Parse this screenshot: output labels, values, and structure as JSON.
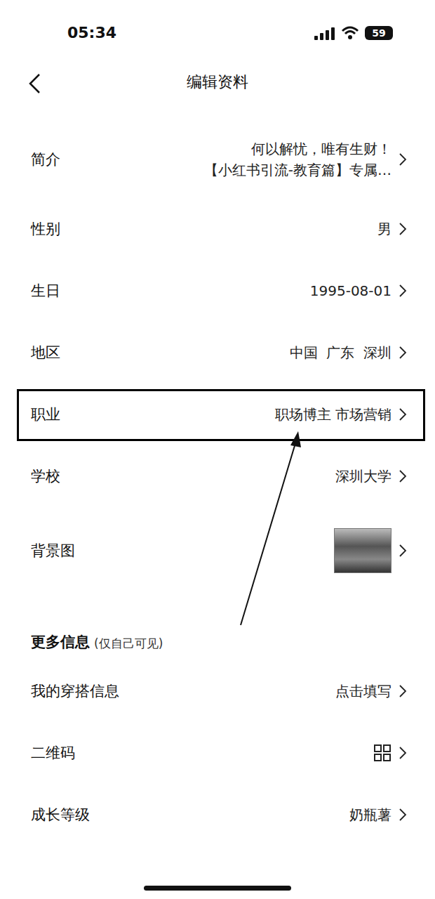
{
  "status_bar": {
    "time": "05:34",
    "battery": "59"
  },
  "header": {
    "title": "编辑资料"
  },
  "rows": [
    {
      "label": "简介",
      "kind": "text",
      "values": [
        "何以解忧，唯有生财！",
        "【小红书引流-教育篇】专属…"
      ],
      "highlighted": false
    },
    {
      "label": "性别",
      "kind": "text",
      "values": [
        "男"
      ],
      "highlighted": false
    },
    {
      "label": "生日",
      "kind": "text",
      "values": [
        "1995-08-01"
      ],
      "highlighted": false
    },
    {
      "label": "地区",
      "kind": "text",
      "values": [
        "中国  广东  深圳"
      ],
      "highlighted": false
    },
    {
      "label": "职业",
      "kind": "text",
      "values": [
        "职场博主 市场营销"
      ],
      "highlighted": true
    },
    {
      "label": "学校",
      "kind": "text",
      "values": [
        "深圳大学"
      ],
      "highlighted": false
    },
    {
      "label": "背景图",
      "kind": "image",
      "values": [],
      "highlighted": false
    }
  ],
  "section": {
    "title": "更多信息",
    "note": "(仅自己可见)"
  },
  "more_rows": [
    {
      "label": "我的穿搭信息",
      "kind": "text",
      "values": [
        "点击填写"
      ],
      "highlighted": false
    },
    {
      "label": "二维码",
      "kind": "icon",
      "values": [],
      "highlighted": false
    },
    {
      "label": "成长等级",
      "kind": "text",
      "values": [
        "奶瓶薯"
      ],
      "highlighted": false
    }
  ]
}
